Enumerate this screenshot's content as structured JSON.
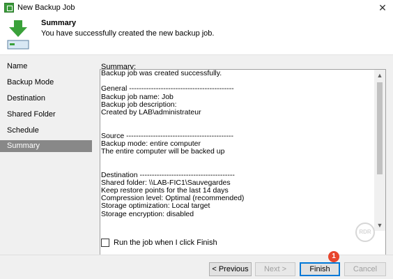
{
  "window": {
    "title": "New Backup Job",
    "close_glyph": "✕"
  },
  "header": {
    "title": "Summary",
    "subtitle": "You have successfully created the new backup job."
  },
  "nav": {
    "items": [
      {
        "label": "Name",
        "active": false
      },
      {
        "label": "Backup Mode",
        "active": false
      },
      {
        "label": "Destination",
        "active": false
      },
      {
        "label": "Shared Folder",
        "active": false
      },
      {
        "label": "Schedule",
        "active": false
      },
      {
        "label": "Summary",
        "active": true
      }
    ]
  },
  "summary": {
    "label": "Summary:",
    "text": "Backup job was created successfully.\n\nGeneral -------------------------------------------\nBackup job name: Job\nBackup job description:\nCreated by LAB\\administrateur\n\n\nSource --------------------------------------------\nBackup mode: entire computer\nThe entire computer will be backed up\n\n\nDestination ---------------------------------------\nShared folder: \\\\LAB-FIC1\\Sauvegardes\nKeep restore points for the last 14 days\nCompression level: Optimal (recommended)\nStorage optimization: Local target\nStorage encryption: disabled"
  },
  "watermark": "RDR",
  "checkbox": {
    "label": "Run the job when I click Finish",
    "checked": false
  },
  "buttons": {
    "previous": "< Previous",
    "next": "Next >",
    "finish": "Finish",
    "cancel": "Cancel"
  },
  "badge": "1",
  "colors": {
    "accent": "#0078d7",
    "nav_active": "#888888",
    "badge": "#e8452c",
    "icon_green": "#3a9a3a"
  }
}
